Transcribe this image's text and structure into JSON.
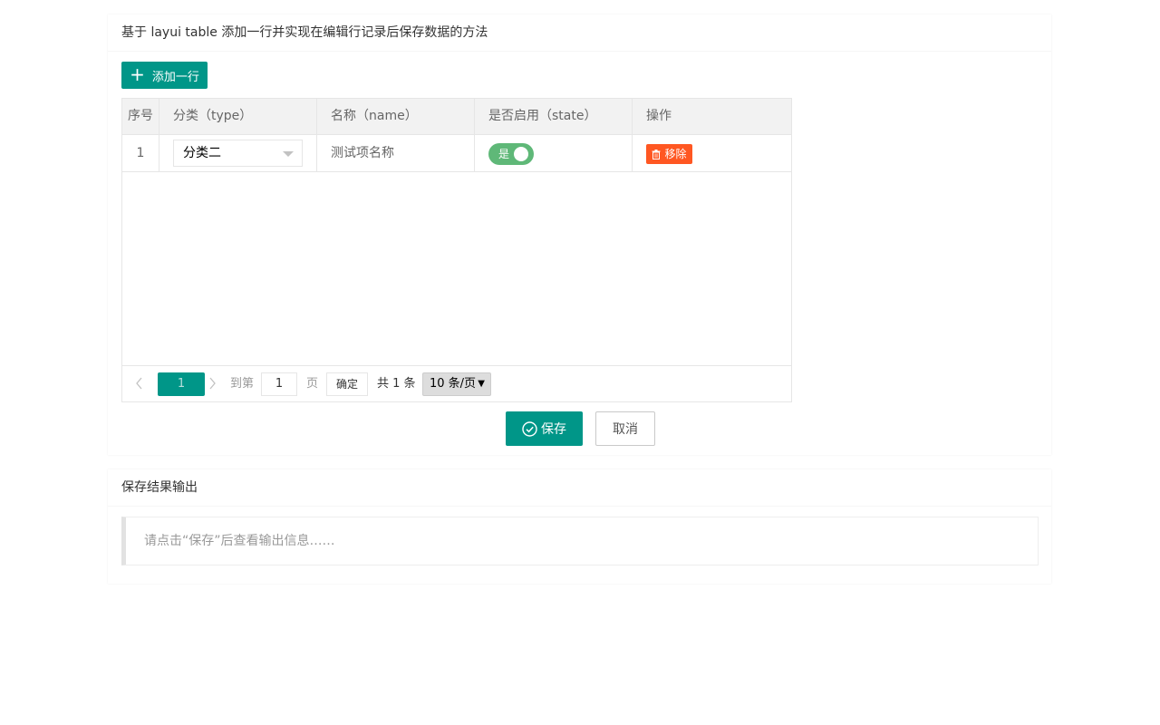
{
  "panel_edit": {
    "title": "基于 layui table 添加一行并实现在编辑行记录后保存数据的方法",
    "add_row_label": "添加一行",
    "table": {
      "columns": [
        "序号",
        "分类（type）",
        "名称（name）",
        "是否启用（state）",
        "操作"
      ],
      "rows": [
        {
          "index": "1",
          "type": "分类二",
          "name": "测试项名称",
          "state_label": "是",
          "action_label": "移除"
        }
      ]
    },
    "pager": {
      "current_page": "1",
      "goto_label": "到第",
      "goto_value": "1",
      "page_label": "页",
      "confirm_label": "确定",
      "total_label": "共 1 条",
      "limit_label": "10 条/页"
    },
    "save_label": "保存",
    "cancel_label": "取消"
  },
  "panel_output": {
    "title": "保存结果输出",
    "message": "请点击“保存”后查看输出信息……"
  },
  "colors": {
    "primary": "#009688",
    "danger": "#ff5722",
    "switch_on": "#5fb878"
  },
  "icons": {
    "add": "plus-icon",
    "remove": "trash-icon",
    "save": "check-circle-icon",
    "prev": "chevron-left-icon",
    "next": "chevron-right-icon",
    "select": "chevron-down-icon"
  }
}
